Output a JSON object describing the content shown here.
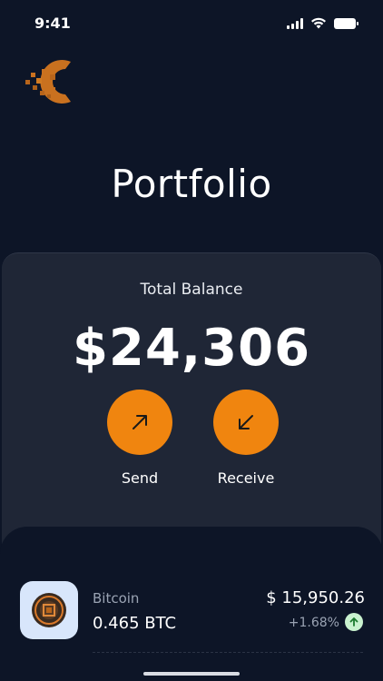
{
  "status_bar": {
    "time": "9:41"
  },
  "header": {
    "title": "Portfolio"
  },
  "balance": {
    "label": "Total Balance",
    "value": "$24,306"
  },
  "actions": {
    "send_label": "Send",
    "receive_label": "Receive"
  },
  "assets": [
    {
      "name": "Bitcoin",
      "amount": "0.465 BTC",
      "value": "$ 15,950.26",
      "change": "+1.68%",
      "trend": "up"
    }
  ],
  "colors": {
    "background": "#0d1527",
    "card": "#1f2636",
    "accent": "#f0850f",
    "positive": "#c9f2cf"
  }
}
